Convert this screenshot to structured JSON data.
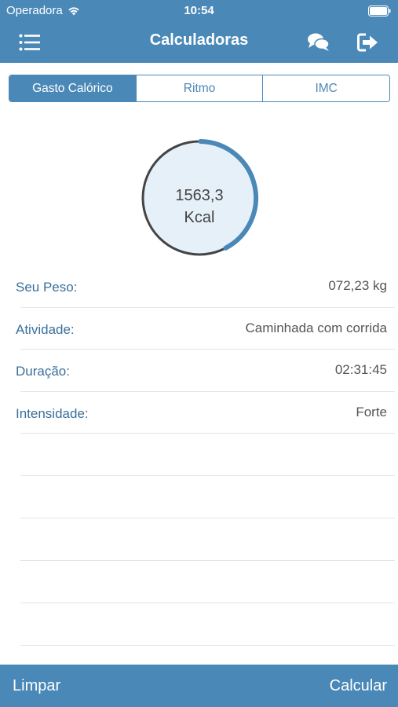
{
  "status_bar": {
    "carrier": "Operadora",
    "time": "10:54"
  },
  "nav": {
    "title": "Calculadoras"
  },
  "tabs": [
    {
      "label": "Gasto Calórico",
      "active": true
    },
    {
      "label": "Ritmo",
      "active": false
    },
    {
      "label": "IMC",
      "active": false
    }
  ],
  "result": {
    "value": "1563,3",
    "unit": "Kcal",
    "progress": 0.42
  },
  "fields": [
    {
      "label": "Seu Peso:",
      "value": "072,23 kg"
    },
    {
      "label": "Atividade:",
      "value": "Caminhada com corrida"
    },
    {
      "label": "Duração:",
      "value": "02:31:45"
    },
    {
      "label": "Intensidade:",
      "value": "Forte"
    }
  ],
  "toolbar": {
    "clear_label": "Limpar",
    "calculate_label": "Calcular"
  },
  "colors": {
    "accent": "#4a88b8",
    "ring_bg": "#e6f0f9",
    "ring_border": "#444444"
  }
}
